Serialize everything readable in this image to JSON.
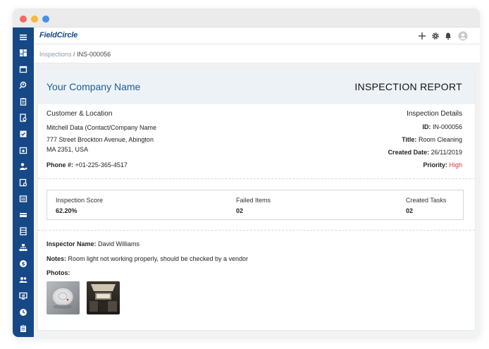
{
  "window": {
    "dots": [
      "red",
      "yellow",
      "blue"
    ]
  },
  "sidebar": {
    "icons": [
      "menu-icon",
      "dashboard-icon",
      "calendar-icon",
      "search-user-icon",
      "clipboard-icon",
      "document-search-icon",
      "checklist-icon",
      "calendar-check-icon",
      "user-settings-icon",
      "inspection-icon",
      "list-icon",
      "truck-icon",
      "table-icon",
      "hierarchy-icon",
      "dollar-icon",
      "users-icon",
      "monitor-icon",
      "clock-icon",
      "report-icon"
    ]
  },
  "topbar": {
    "logo": "FieldCircle",
    "icons": [
      "plus-icon",
      "gear-icon",
      "bell-icon",
      "user-avatar-icon"
    ]
  },
  "breadcrumb": {
    "parent": "Inspections",
    "separator": " / ",
    "current": "INS-000056"
  },
  "report": {
    "company_name": "Your Company Name",
    "title": "INSPECTION REPORT",
    "customer": {
      "heading": "Customer & Location",
      "contact": "Mitchell Data (Contact/Company Name",
      "address1": "777 Street Brockton Avenue, Abington",
      "address2": "MA 2351, USA",
      "phone_label": "Phone #:",
      "phone": "+01-225-365-4517"
    },
    "details": {
      "heading": "Inspection Details",
      "id_label": "ID:",
      "id": "IN-000056",
      "title_label": "Title:",
      "title": "Room Cleaning",
      "created_label": "Created Date:",
      "created": "26/11/2019",
      "priority_label": "Priority:",
      "priority": "High",
      "priority_color": "#d9363e"
    },
    "scores": [
      {
        "label": "Inspection Score",
        "value": "62.20%"
      },
      {
        "label": "Failed Items",
        "value": "02"
      },
      {
        "label": "Created Tasks",
        "value": "02"
      }
    ],
    "inspector_label": "Inspector Name:",
    "inspector": "David Williams",
    "notes_label": "Notes:",
    "notes": "Room light not working properly, should be checked by a vendor",
    "photos_label": "Photos:"
  },
  "colors": {
    "brand": "#174886",
    "accent": "#1d5a93",
    "header_bg": "#edf2f7"
  }
}
